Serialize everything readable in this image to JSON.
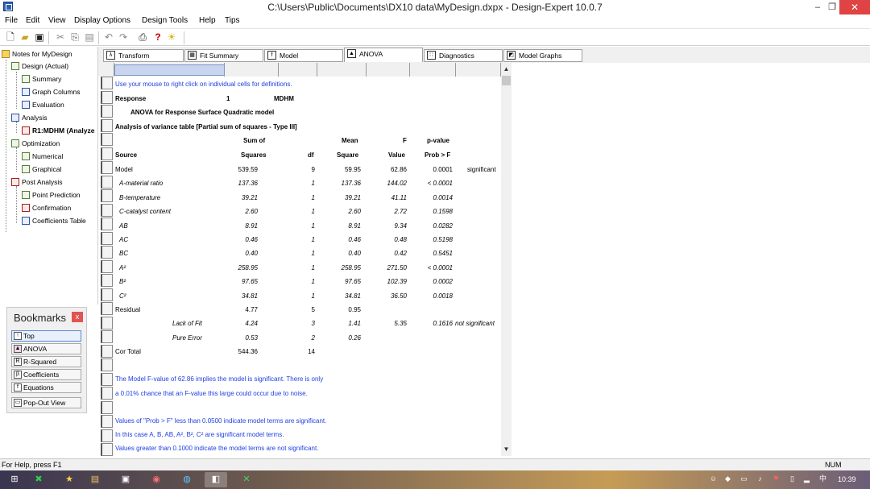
{
  "window": {
    "title": "C:\\Users\\Public\\Documents\\DX10 data\\MyDesign.dxpx - Design-Expert 10.0.7",
    "minimize": "–",
    "maximize": "❐",
    "close": "✕"
  },
  "menu": [
    "File",
    "Edit",
    "View",
    "Display Options",
    "Design Tools",
    "Help",
    "Tips"
  ],
  "toolbar_icons": [
    "new-file-icon",
    "open-folder-icon",
    "save-icon",
    "cut-icon",
    "copy-icon",
    "paste-icon",
    "undo-icon",
    "redo-icon",
    "print-icon",
    "help-icon",
    "tip-bulb-icon"
  ],
  "tree": {
    "items": [
      {
        "label": "Notes for MyDesign"
      },
      {
        "label": "Design (Actual)"
      },
      {
        "label": "Summary"
      },
      {
        "label": "Graph Columns"
      },
      {
        "label": "Evaluation"
      },
      {
        "label": "Analysis"
      },
      {
        "label": "R1:MDHM (Analyze"
      },
      {
        "label": "Optimization"
      },
      {
        "label": "Numerical"
      },
      {
        "label": "Graphical"
      },
      {
        "label": "Post Analysis"
      },
      {
        "label": "Point Prediction"
      },
      {
        "label": "Confirmation"
      },
      {
        "label": "Coefficients Table"
      }
    ]
  },
  "bookmarks": {
    "title": "Bookmarks",
    "close": "x",
    "items": [
      "Top",
      "ANOVA",
      "R-Squared",
      "Coefficients",
      "Equations"
    ],
    "popout": "Pop-Out View"
  },
  "tabs": [
    "Transform",
    "Fit Summary",
    "Model",
    "ANOVA",
    "Diagnostics",
    "Model Graphs"
  ],
  "report": {
    "hint": "Use your mouse to right click on individual cells for definitions.",
    "response_label": "Response",
    "response_num": "1",
    "response_name": "MDHM",
    "anova_title": "ANOVA for Response Surface Quadratic model",
    "anova_subtitle": "Analysis of variance table [Partial sum of squares - Type III]",
    "headers": {
      "row1": [
        "Sum of",
        "Mean",
        "F",
        "p-value"
      ],
      "row2": [
        "Source",
        "Squares",
        "df",
        "Square",
        "Value",
        "Prob > F"
      ]
    },
    "rows": [
      {
        "source": "Model",
        "ss": "539.59",
        "df": "9",
        "ms": "59.95",
        "f": "62.86",
        "p": "0.0001",
        "note": "significant",
        "style": "plain"
      },
      {
        "source": "A-material ratio",
        "ss": "137.36",
        "df": "1",
        "ms": "137.36",
        "f": "144.02",
        "p": "< 0.0001",
        "note": "",
        "style": "italic"
      },
      {
        "source": "B-temperature",
        "ss": "39.21",
        "df": "1",
        "ms": "39.21",
        "f": "41.11",
        "p": "0.0014",
        "note": "",
        "style": "italic"
      },
      {
        "source": "C-catalyst content",
        "ss": "2.60",
        "df": "1",
        "ms": "2.60",
        "f": "2.72",
        "p": "0.1598",
        "note": "",
        "style": "italic"
      },
      {
        "source": "AB",
        "ss": "8.91",
        "df": "1",
        "ms": "8.91",
        "f": "9.34",
        "p": "0.0282",
        "note": "",
        "style": "italic"
      },
      {
        "source": "AC",
        "ss": "0.46",
        "df": "1",
        "ms": "0.46",
        "f": "0.48",
        "p": "0.5198",
        "note": "",
        "style": "italic"
      },
      {
        "source": "BC",
        "ss": "0.40",
        "df": "1",
        "ms": "0.40",
        "f": "0.42",
        "p": "0.5451",
        "note": "",
        "style": "italic"
      },
      {
        "source": "A²",
        "ss": "258.95",
        "df": "1",
        "ms": "258.95",
        "f": "271.50",
        "p": "< 0.0001",
        "note": "",
        "style": "italic"
      },
      {
        "source": "B²",
        "ss": "97.65",
        "df": "1",
        "ms": "97.65",
        "f": "102.39",
        "p": "0.0002",
        "note": "",
        "style": "italic"
      },
      {
        "source": "C²",
        "ss": "34.81",
        "df": "1",
        "ms": "34.81",
        "f": "36.50",
        "p": "0.0018",
        "note": "",
        "style": "italic"
      },
      {
        "source": "Residual",
        "ss": "4.77",
        "df": "5",
        "ms": "0.95",
        "f": "",
        "p": "",
        "note": "",
        "style": "plain"
      },
      {
        "source": "Lack of Fit",
        "ss": "4.24",
        "df": "3",
        "ms": "1.41",
        "f": "5.35",
        "p": "0.1616",
        "note": "not significant",
        "style": "sub"
      },
      {
        "source": "Pure Error",
        "ss": "0.53",
        "df": "2",
        "ms": "0.26",
        "f": "",
        "p": "",
        "note": "",
        "style": "sub"
      },
      {
        "source": "Cor Total",
        "ss": "544.36",
        "df": "14",
        "ms": "",
        "f": "",
        "p": "",
        "note": "",
        "style": "plain"
      }
    ],
    "notes": [
      "The Model F-value of 62.86 implies the model is significant. There is only",
      "a 0.01% chance that an F-value this large could occur due to noise.",
      "Values of \"Prob > F\" less than 0.0500 indicate model terms are significant.",
      "In this case A, B, AB, A², B², C² are significant model terms.",
      "Values greater than 0.1000 indicate the model terms are not significant."
    ]
  },
  "status": {
    "help": "For Help, press F1",
    "num": "NUM"
  },
  "taskbar": {
    "time": "10:39",
    "ime": "中"
  }
}
